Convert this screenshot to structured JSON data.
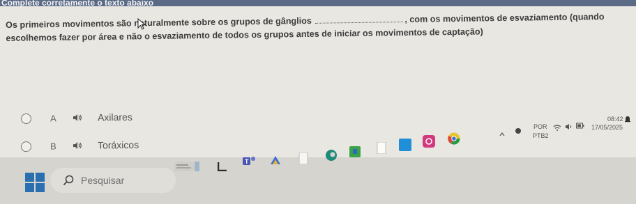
{
  "header": {
    "title": "Complete corretamente o texto abaixo"
  },
  "question": {
    "line1_before": "Os primeiros movimentos são naturalmente sobre os grupos de gânglios",
    "line1_after": ", com os movimentos de esvaziamento (quando",
    "line2": "escolhemos fazer por área e não o esvaziamento de todos os grupos antes de iniciar os movimentos de captação)"
  },
  "options": [
    {
      "letter": "A",
      "label": "Axilares",
      "icon": "speaker-icon"
    },
    {
      "letter": "B",
      "label": "Toráxicos",
      "icon": "speaker-icon"
    }
  ],
  "taskbar": {
    "search_placeholder": "Pesquisar",
    "apps": [
      "weather-widget",
      "file-explorer-icon",
      "whatsapp-icon",
      "teams-icon",
      "copilot-icon",
      "notepad-icon",
      "edge-icon",
      "store-icon",
      "files-icon",
      "instagram-icon",
      "chrome-icon"
    ],
    "language": "POR",
    "keyboard": "PTB2",
    "time": "08:42",
    "date": "17/05/2025"
  },
  "colors": {
    "header_bg": "#5b6b86",
    "page_bg": "#e9e7e1",
    "taskbar_bg": "#d6d4cf",
    "windows_blue": "#2a6fb0"
  }
}
